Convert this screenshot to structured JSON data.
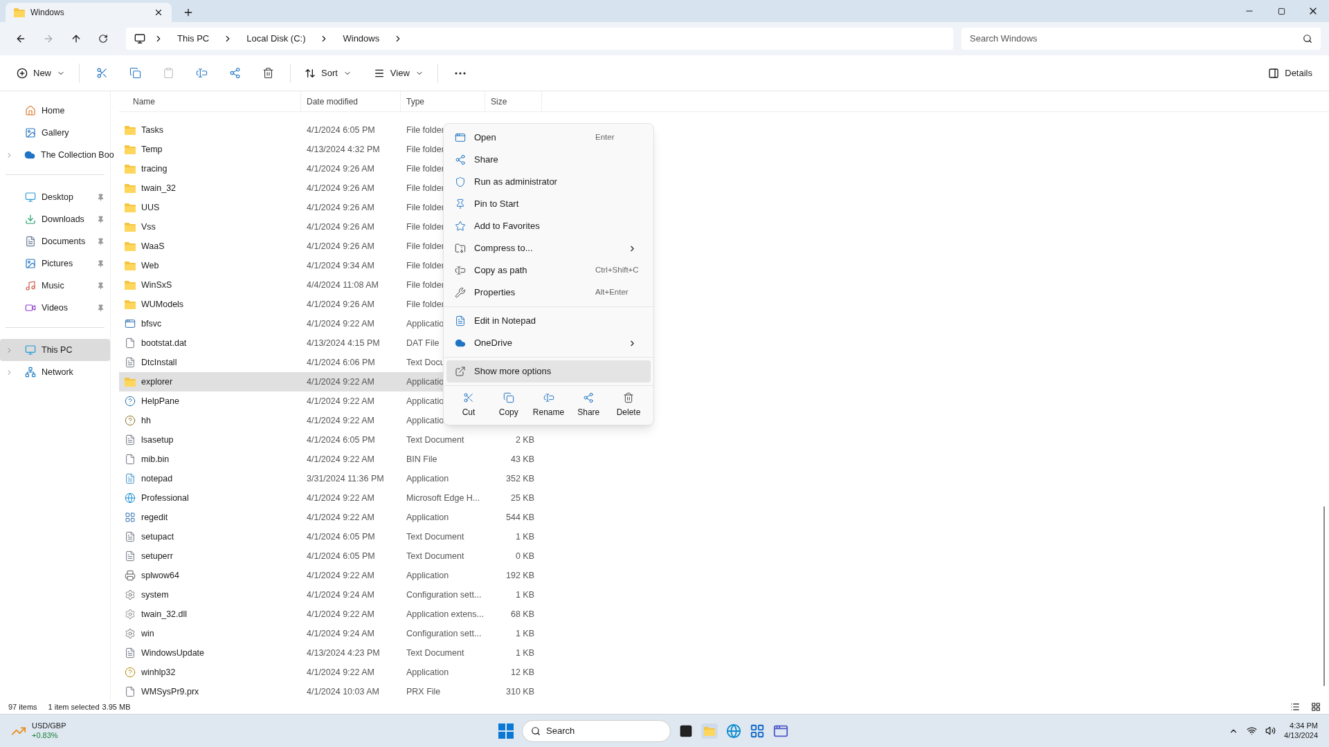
{
  "tab": {
    "title": "Windows",
    "selected": true
  },
  "breadcrumb": [
    "This PC",
    "Local Disk (C:)",
    "Windows"
  ],
  "search": {
    "placeholder": "Search Windows"
  },
  "toolbar": {
    "new": "New",
    "sort": "Sort",
    "view": "View",
    "details": "Details"
  },
  "sidebar": {
    "groups": [
      [
        {
          "label": "Home",
          "kind": "home",
          "selected": false
        },
        {
          "label": "Gallery",
          "kind": "gallery",
          "selected": false
        },
        {
          "label": "The Collection Boo",
          "kind": "cloud",
          "expandable": true,
          "selected": false
        }
      ],
      [
        {
          "label": "Desktop",
          "kind": "desktop",
          "pinned": true,
          "selected": false
        },
        {
          "label": "Downloads",
          "kind": "download",
          "pinned": true,
          "selected": false
        },
        {
          "label": "Documents",
          "kind": "document",
          "pinned": true,
          "selected": false
        },
        {
          "label": "Pictures",
          "kind": "picture",
          "pinned": true,
          "selected": false
        },
        {
          "label": "Music",
          "kind": "music",
          "pinned": true,
          "selected": false
        },
        {
          "label": "Videos",
          "kind": "video",
          "pinned": true,
          "selected": false
        }
      ],
      [
        {
          "label": "This PC",
          "kind": "pc",
          "expandable": true,
          "selected": true
        },
        {
          "label": "Network",
          "kind": "network",
          "expandable": true,
          "selected": false
        }
      ]
    ]
  },
  "table": {
    "columns": [
      "Name",
      "Date modified",
      "Type",
      "Size"
    ],
    "rows": [
      {
        "name": "Tasks",
        "kind": "folder",
        "date": "4/1/2024 6:05 PM",
        "type": "File folder",
        "selected": false
      },
      {
        "name": "Temp",
        "kind": "folder",
        "date": "4/13/2024 4:32 PM",
        "type": "File folder",
        "selected": false
      },
      {
        "name": "tracing",
        "kind": "folder",
        "date": "4/1/2024 9:26 AM",
        "type": "File folder",
        "selected": false
      },
      {
        "name": "twain_32",
        "kind": "folder",
        "date": "4/1/2024 9:26 AM",
        "type": "File folder",
        "selected": false
      },
      {
        "name": "UUS",
        "kind": "folder",
        "date": "4/1/2024 9:26 AM",
        "type": "File folder",
        "selected": false
      },
      {
        "name": "Vss",
        "kind": "folder",
        "date": "4/1/2024 9:26 AM",
        "type": "File folder",
        "selected": false
      },
      {
        "name": "WaaS",
        "kind": "folder",
        "date": "4/1/2024 9:26 AM",
        "type": "File folder",
        "selected": false
      },
      {
        "name": "Web",
        "kind": "folder",
        "date": "4/1/2024 9:34 AM",
        "type": "File folder",
        "selected": false
      },
      {
        "name": "WinSxS",
        "kind": "folder",
        "date": "4/4/2024 11:08 AM",
        "type": "File folder",
        "selected": false
      },
      {
        "name": "WUModels",
        "kind": "folder",
        "date": "4/1/2024 9:26 AM",
        "type": "File folder",
        "selected": false
      },
      {
        "name": "bfsvc",
        "kind": "app",
        "date": "4/1/2024 9:22 AM",
        "type": "Applicatio",
        "selected": false
      },
      {
        "name": "bootstat.dat",
        "kind": "file",
        "date": "4/13/2024 4:15 PM",
        "type": "DAT File",
        "selected": false
      },
      {
        "name": "DtcInstall",
        "kind": "text",
        "date": "4/1/2024 6:06 PM",
        "type": "Text Docu",
        "selected": false
      },
      {
        "name": "explorer",
        "kind": "explorer",
        "date": "4/1/2024 9:22 AM",
        "type": "Applicatio",
        "selected": true
      },
      {
        "name": "HelpPane",
        "kind": "help",
        "date": "4/1/2024 9:22 AM",
        "type": "Applicatio",
        "selected": false
      },
      {
        "name": "hh",
        "kind": "helpdoc",
        "date": "4/1/2024 9:22 AM",
        "type": "Applicatio",
        "selected": false
      },
      {
        "name": "lsasetup",
        "kind": "text",
        "date": "4/1/2024 6:05 PM",
        "type": "Text Document",
        "size": "2 KB",
        "selected": false
      },
      {
        "name": "mib.bin",
        "kind": "file",
        "date": "4/1/2024 9:22 AM",
        "type": "BIN File",
        "size": "43 KB",
        "selected": false
      },
      {
        "name": "notepad",
        "kind": "notepad",
        "date": "3/31/2024 11:36 PM",
        "type": "Application",
        "size": "352 KB",
        "selected": false
      },
      {
        "name": "Professional",
        "kind": "edge",
        "date": "4/1/2024 9:22 AM",
        "type": "Microsoft Edge H...",
        "size": "25 KB",
        "selected": false
      },
      {
        "name": "regedit",
        "kind": "registry",
        "date": "4/1/2024 9:22 AM",
        "type": "Application",
        "size": "544 KB",
        "selected": false
      },
      {
        "name": "setupact",
        "kind": "text",
        "date": "4/1/2024 6:05 PM",
        "type": "Text Document",
        "size": "1 KB",
        "selected": false
      },
      {
        "name": "setuperr",
        "kind": "text",
        "date": "4/1/2024 6:05 PM",
        "type": "Text Document",
        "size": "0 KB",
        "selected": false
      },
      {
        "name": "splwow64",
        "kind": "printer",
        "date": "4/1/2024 9:22 AM",
        "type": "Application",
        "size": "192 KB",
        "selected": false
      },
      {
        "name": "system",
        "kind": "config",
        "date": "4/1/2024 9:24 AM",
        "type": "Configuration sett...",
        "size": "1 KB",
        "selected": false
      },
      {
        "name": "twain_32.dll",
        "kind": "dll",
        "date": "4/1/2024 9:22 AM",
        "type": "Application extens...",
        "size": "68 KB",
        "selected": false
      },
      {
        "name": "win",
        "kind": "config",
        "date": "4/1/2024 9:24 AM",
        "type": "Configuration sett...",
        "size": "1 KB",
        "selected": false
      },
      {
        "name": "WindowsUpdate",
        "kind": "text",
        "date": "4/13/2024 4:23 PM",
        "type": "Text Document",
        "size": "1 KB",
        "selected": false
      },
      {
        "name": "winhlp32",
        "kind": "help2",
        "date": "4/1/2024 9:22 AM",
        "type": "Application",
        "size": "12 KB",
        "selected": false
      },
      {
        "name": "WMSysPr9.prx",
        "kind": "file",
        "date": "4/1/2024 10:03 AM",
        "type": "PRX File",
        "size": "310 KB",
        "selected": false
      }
    ]
  },
  "context_menu": {
    "sections": [
      [
        {
          "label": "Open",
          "kind": "open",
          "shortcut": "Enter"
        },
        {
          "label": "Share",
          "kind": "share"
        },
        {
          "label": "Run as administrator",
          "kind": "admin"
        },
        {
          "label": "Pin to Start",
          "kind": "pin"
        },
        {
          "label": "Add to Favorites",
          "kind": "star"
        },
        {
          "label": "Compress to...",
          "kind": "zip",
          "submenu": true
        },
        {
          "label": "Copy as path",
          "kind": "path",
          "shortcut": "Ctrl+Shift+C"
        },
        {
          "label": "Properties",
          "kind": "wrench",
          "shortcut": "Alt+Enter"
        }
      ],
      [
        {
          "label": "Edit in Notepad",
          "kind": "notepad"
        },
        {
          "label": "OneDrive",
          "kind": "cloud",
          "submenu": true
        }
      ],
      [
        {
          "label": "Show more options",
          "kind": "more",
          "highlighted": true
        }
      ]
    ],
    "actions": [
      {
        "label": "Cut",
        "kind": "cut"
      },
      {
        "label": "Copy",
        "kind": "copy"
      },
      {
        "label": "Rename",
        "kind": "rename"
      },
      {
        "label": "Share",
        "kind": "share"
      },
      {
        "label": "Delete",
        "kind": "delete"
      }
    ]
  },
  "status_bar": {
    "count": "97 items",
    "selection": "1 item selected",
    "size": "3.95 MB"
  },
  "taskbar": {
    "widget": {
      "title": "USD/GBP",
      "change": "+0.83%"
    },
    "search": "Search",
    "time": "4:34 PM",
    "date": "4/13/2024"
  }
}
